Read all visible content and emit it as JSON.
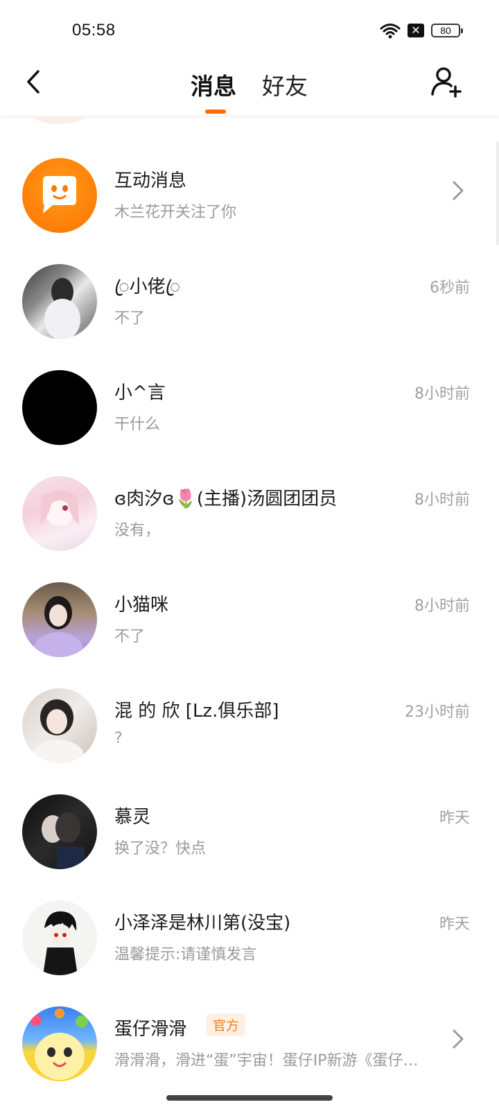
{
  "status_bar": {
    "time": "05:58",
    "battery": "80",
    "sim_glyph": "✕"
  },
  "header": {
    "tabs": [
      {
        "label": "消息",
        "active": true
      },
      {
        "label": "好友",
        "active": false
      }
    ],
    "accent_color": "#ff6a00",
    "icons": [
      "back-arrow-icon",
      "add-friend-icon"
    ]
  },
  "conversations": [
    {
      "name": "互动消息",
      "preview": "木兰花开关注了你",
      "time": "",
      "chevron": true,
      "avatar": "orange-chat-bubble-icon"
    },
    {
      "name": "ꦿ小佬ꦿ",
      "preview": "不了",
      "time": "6秒前",
      "avatar": "photo-avatar"
    },
    {
      "name": "小^言",
      "preview": "干什么",
      "time": "8小时前",
      "avatar": "black-avatar"
    },
    {
      "name": "ɞ肉汐ɞ🌷(主播)汤圆团团员",
      "preview": "没有，",
      "time": "8小时前",
      "avatar": "anime-avatar"
    },
    {
      "name": "小猫咪",
      "preview": "不了",
      "time": "8小时前",
      "avatar": "photo-avatar"
    },
    {
      "name": "混  的  欣 [Lz.俱乐部]",
      "preview": "?",
      "time": "23小时前",
      "avatar": "photo-avatar"
    },
    {
      "name": "慕灵",
      "preview": "换了没？快点",
      "time": "昨天",
      "avatar": "dark-photo-avatar"
    },
    {
      "name": "小泽泽是林川第(没宝)",
      "preview": "温馨提示:请谨慎发言",
      "time": "昨天",
      "avatar": "cartoon-avatar"
    },
    {
      "name": "蛋仔滑滑",
      "badge": "官方",
      "preview": "滑滑滑，滑进“蛋”宇宙！蛋仔IP新游《蛋仔…",
      "time": "",
      "chevron": true,
      "avatar": "eggy-avatar"
    }
  ]
}
